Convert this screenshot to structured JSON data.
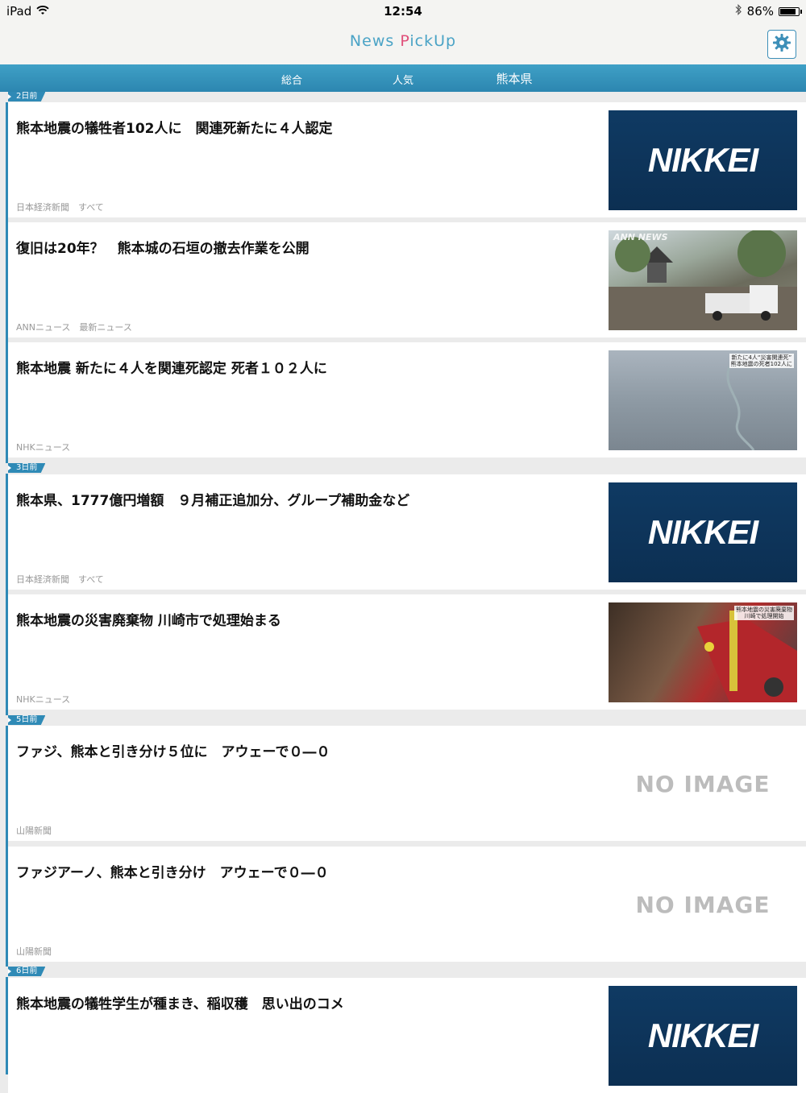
{
  "status_bar": {
    "device": "iPad",
    "time": "12:54",
    "battery": "86%",
    "battery_level": 0.86
  },
  "nav": {
    "title_part1": "News ",
    "title_part2": "P",
    "title_part3": "ickUp",
    "settings_icon": "gear-icon"
  },
  "tabs": [
    {
      "label": "総合"
    },
    {
      "label": "人気"
    },
    {
      "label": "熊本県"
    }
  ],
  "sections": [
    {
      "day": "2日前"
    },
    {
      "day": "3日前"
    },
    {
      "day": "5日前"
    },
    {
      "day": "6日前"
    }
  ],
  "articles": [
    {
      "title": "熊本地震の犠牲者102人に　関連死新たに４人認定",
      "source": "日本経済新聞　すべて",
      "thumb": "NIKKEI"
    },
    {
      "title": "復旧は20年？　熊本城の石垣の撤去作業を公開",
      "source": "ANNニュース　最新ニュース",
      "thumb_caption": "ANN NEWS"
    },
    {
      "title": "熊本地震 新たに４人を関連死認定 死者１０２人に",
      "source": "NHKニュース",
      "thumb_caption": "新たに4人“災害関連死”\n熊本地震の死者102人に"
    },
    {
      "title": "熊本県、1777億円増額　９月補正追加分、グループ補助金など",
      "source": "日本経済新聞　すべて",
      "thumb": "NIKKEI"
    },
    {
      "title": "熊本地震の災害廃棄物 川崎市で処理始まる",
      "source": "NHKニュース",
      "thumb_caption": "熊本地震の災害廃棄物\n川崎で処理開始"
    },
    {
      "title": "ファジ、熊本と引き分け５位に　アウェーで０―０",
      "source": "山陽新聞",
      "thumb": "NO IMAGE"
    },
    {
      "title": "ファジアーノ、熊本と引き分け　アウェーで０―０",
      "source": "山陽新聞",
      "thumb": "NO IMAGE"
    },
    {
      "title": "熊本地震の犠牲学生が種まき、稲収穫　思い出のコメ",
      "source": "",
      "thumb": "NIKKEI"
    }
  ]
}
